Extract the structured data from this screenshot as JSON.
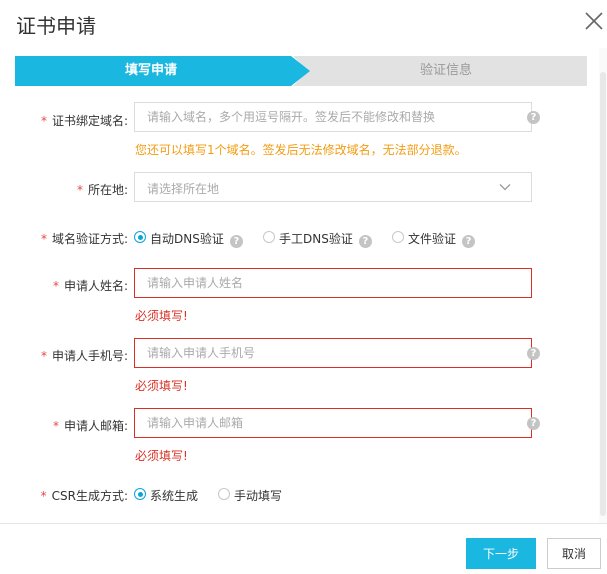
{
  "dialog": {
    "title": "证书申请"
  },
  "steps": [
    {
      "label": "填写申请",
      "active": true
    },
    {
      "label": "验证信息",
      "active": false
    }
  ],
  "form": {
    "domain": {
      "label": "证书绑定域名:",
      "placeholder": "请输入域名，多个用逗号隔开。签发后不能修改和替换",
      "value": "",
      "hint": "您还可以填写1个域名。签发后无法修改域名，无法部分退款。"
    },
    "location": {
      "label": "所在地:",
      "placeholder": "请选择所在地"
    },
    "verify_method": {
      "label": "域名验证方式:",
      "options": [
        {
          "label": "自动DNS验证",
          "selected": true
        },
        {
          "label": "手工DNS验证",
          "selected": false
        },
        {
          "label": "文件验证",
          "selected": false
        }
      ]
    },
    "applicant_name": {
      "label": "申请人姓名:",
      "placeholder": "请输入申请人姓名",
      "value": "",
      "error": "必须填写!"
    },
    "applicant_phone": {
      "label": "申请人手机号:",
      "placeholder": "请输入申请人手机号",
      "value": "",
      "error": "必须填写!"
    },
    "applicant_email": {
      "label": "申请人邮箱:",
      "placeholder": "请输入申请人邮箱",
      "value": "",
      "error": "必须填写!"
    },
    "csr": {
      "label": "CSR生成方式:",
      "options": [
        {
          "label": "系统生成",
          "selected": true
        },
        {
          "label": "手动填写",
          "selected": false
        }
      ]
    }
  },
  "required_mark": "*",
  "help_glyph": "?",
  "footer": {
    "next_label": "下一步",
    "cancel_label": "取消"
  },
  "colors": {
    "accent": "#1ab7e0",
    "error": "#d93026",
    "warning": "#f39c12"
  }
}
